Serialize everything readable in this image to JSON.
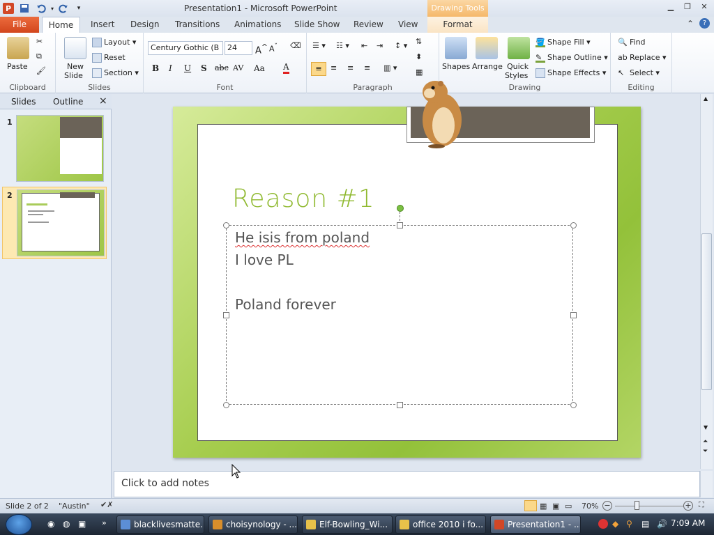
{
  "app": {
    "title": "Presentation1  -  Microsoft PowerPoint",
    "context_tab_group": "Drawing Tools",
    "icon_letter": "P"
  },
  "tabs": [
    "File",
    "Home",
    "Insert",
    "Design",
    "Transitions",
    "Animations",
    "Slide Show",
    "Review",
    "View",
    "Format"
  ],
  "ribbon": {
    "clipboard": {
      "label": "Clipboard",
      "paste": "Paste"
    },
    "slides": {
      "label": "Slides",
      "new_slide_1": "New",
      "new_slide_2": "Slide",
      "layout": "Layout",
      "reset": "Reset",
      "section": "Section"
    },
    "font": {
      "label": "Font",
      "font_name": "Century Gothic (B",
      "font_size": "24",
      "bold": "B",
      "italic": "I",
      "underline": "U",
      "shadow": "S",
      "strike": "abc",
      "spacing": "AV",
      "case": "Aa",
      "color": "A"
    },
    "paragraph": {
      "label": "Paragraph"
    },
    "drawing": {
      "label": "Drawing",
      "shapes": "Shapes",
      "arrange": "Arrange",
      "quick_styles_1": "Quick",
      "quick_styles_2": "Styles",
      "shape_fill": "Shape Fill",
      "shape_outline": "Shape Outline",
      "shape_effects": "Shape Effects"
    },
    "editing": {
      "label": "Editing",
      "find": "Find",
      "replace": "Replace",
      "select": "Select"
    }
  },
  "leftpane": {
    "tabs": [
      "Slides",
      "Outline"
    ],
    "close": "×",
    "slide_numbers": [
      "1",
      "2"
    ]
  },
  "slide": {
    "title": "Reason #1",
    "body_lines": [
      "He isis from poland",
      "I love PL",
      "",
      "Poland forever"
    ]
  },
  "notes": {
    "placeholder": "Click to add notes"
  },
  "status": {
    "slide": "Slide 2 of 2",
    "theme": "\"Austin\"",
    "zoom": "70%"
  },
  "taskbar": {
    "items": [
      "blacklivesmatte...",
      "choisynology - ...",
      "Elf-Bowling_Wi...",
      "office 2010 i fo...",
      "Presentation1 - ..."
    ],
    "clock": "7:09 AM"
  },
  "colors": {
    "accent_green": "#8fb92f",
    "file_tab": "#d2461d",
    "context_tab": "#f5b86a"
  }
}
